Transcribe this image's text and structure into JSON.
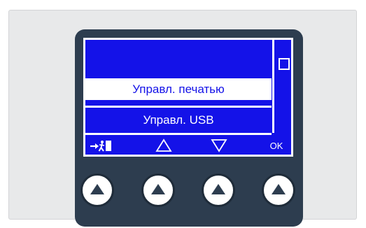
{
  "menu": {
    "items": [
      "",
      "Управл. печатью",
      "Управл. USB"
    ],
    "selected_index": 1
  },
  "softkeys": {
    "ok_label": "OK",
    "back_icon": "exit-icon",
    "up_icon": "up-triangle-icon",
    "down_icon": "down-triangle-icon"
  },
  "colors": {
    "screen_blue": "#1412e8",
    "device_body": "#2d3d4f",
    "panel_bg": "#e8e9ea"
  }
}
